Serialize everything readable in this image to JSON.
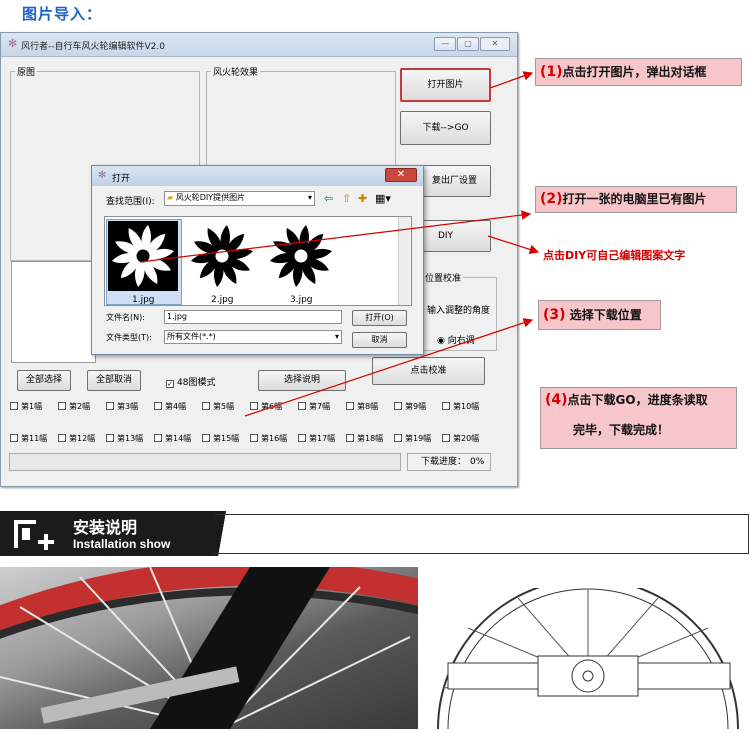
{
  "section_title": "图片导入：",
  "window": {
    "title": "风行者--自行车风火轮编辑软件V2.0",
    "controls": [
      "—",
      "▢",
      "✕"
    ],
    "group_original": "原图",
    "group_effect": "风火轮效果",
    "group_position": "位置校准",
    "buttons": {
      "open_image": "打开图片",
      "download_go": "下载-->GO",
      "factory_reset": "复出厂设置",
      "diy": "DIY",
      "select_all": "全部选择",
      "deselect_all": "全部取消",
      "help": "选择说明",
      "calibrate": "点击校准"
    },
    "checkbox_48": "48图模式",
    "angle_label": "输入调整的角度",
    "radio_right": "向右调",
    "frames_row1": [
      "第1幅",
      "第2幅",
      "第3幅",
      "第4幅",
      "第5幅",
      "第6幅",
      "第7幅",
      "第8幅",
      "第9幅",
      "第10幅"
    ],
    "frames_row2": [
      "第11幅",
      "第12幅",
      "第13幅",
      "第14幅",
      "第15幅",
      "第16幅",
      "第17幅",
      "第18幅",
      "第19幅",
      "第20幅"
    ],
    "progress_label": "下载进度：",
    "progress_value": "0%"
  },
  "dialog": {
    "title": "打开",
    "look_in_label": "查找范围(I):",
    "look_in_value": "风火轮DIY提供图片",
    "files": [
      "1.jpg",
      "2.jpg",
      "3.jpg"
    ],
    "filename_label": "文件名(N):",
    "filename_value": "1.jpg",
    "filetype_label": "文件类型(T):",
    "filetype_value": "所有文件(*.*)",
    "open_button": "打开(O)",
    "cancel_button": "取消"
  },
  "callouts": {
    "c1_num": "(1)",
    "c1_text": "点击打开图片，弹出对话框",
    "c2_num": "(2)",
    "c2_text": "打开一张的电脑里已有图片",
    "diy_note": "点击DIY可自己编辑图案文字",
    "c3_num": "(3)",
    "c3_text": "选择下载位置",
    "c4_num": "(4)",
    "c4_line1": "点击下载GO，进度条读取",
    "c4_line2": "完毕，下载完成！"
  },
  "install": {
    "title_cn": "安装说明",
    "title_en": "Installation show"
  },
  "icons": [
    "app-icon",
    "folder-icon",
    "back-arrow-icon",
    "up-folder-icon",
    "new-folder-icon",
    "view-menu-icon",
    "dropdown-arrow-icon",
    "install-logo-icon"
  ],
  "colors": {
    "callout_bg": "#f7c6ca",
    "accent_red": "#d40000",
    "title_blue": "#1a62c8",
    "band_dark": "#1b1b1b"
  }
}
